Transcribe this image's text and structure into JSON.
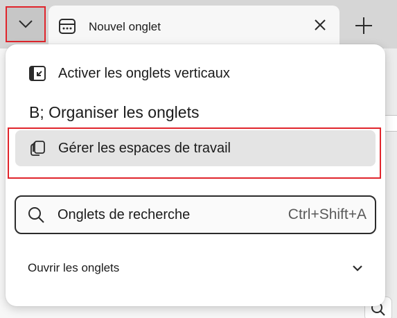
{
  "tabstrip": {
    "tab_title": "Nouvel onglet",
    "icons": {
      "tab_actions": "chevron-down-icon",
      "favicon": "new-tab-page-icon",
      "close": "close-icon",
      "new_tab": "plus-icon"
    }
  },
  "menu": {
    "items": [
      {
        "label": "Activer les onglets verticaux",
        "icon": "vertical-tabs-icon"
      },
      {
        "label": "B; Organiser les onglets",
        "icon": ""
      },
      {
        "label": "Gérer les espaces de travail",
        "icon": "workspaces-icon"
      }
    ],
    "search": {
      "placeholder": "Onglets de recherche",
      "shortcut": "Ctrl+Shift+A",
      "icon": "search-icon"
    },
    "open_tabs": {
      "label": "Ouvrir les onglets",
      "icon": "chevron-down-icon"
    }
  },
  "colors": {
    "highlight_outline": "#e0242b",
    "hovered_item": "#e4e4e4",
    "menu_background": "#ffffff"
  }
}
